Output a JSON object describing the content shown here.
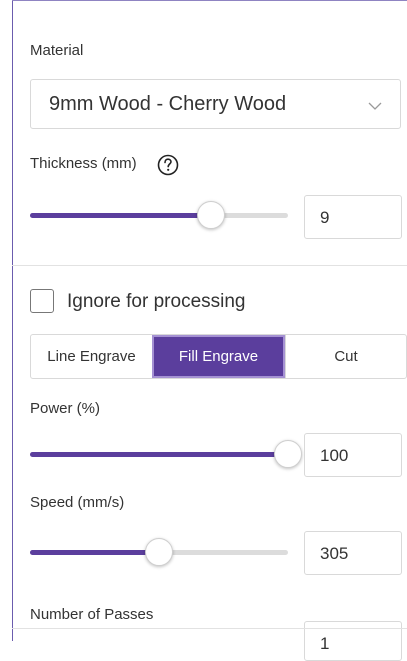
{
  "material": {
    "label": "Material",
    "selected": "9mm Wood - Cherry Wood"
  },
  "thickness": {
    "label": "Thickness (mm)",
    "value": "9",
    "slider_fraction": 0.7
  },
  "ignore": {
    "label": "Ignore for processing",
    "checked": false
  },
  "modes": {
    "tabs": [
      "Line Engrave",
      "Fill Engrave",
      "Cut"
    ],
    "active": "Fill Engrave"
  },
  "power": {
    "label": "Power (%)",
    "value": "100",
    "slider_fraction": 1.0
  },
  "speed": {
    "label": "Speed (mm/s)",
    "value": "305",
    "slider_fraction": 0.5
  },
  "passes": {
    "label": "Number of Passes",
    "value": "1"
  },
  "colors": {
    "accent": "#5b3e9d",
    "track": "#dcdcdc"
  }
}
